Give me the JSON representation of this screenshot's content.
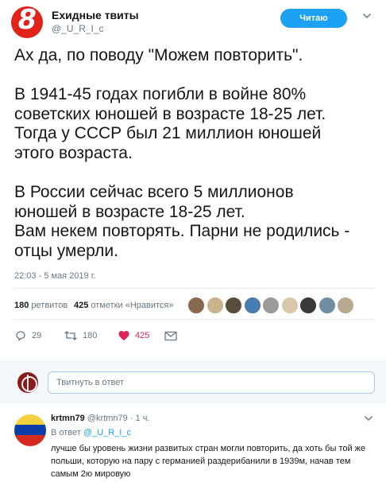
{
  "account": {
    "avatar_text": "8",
    "name": "Ехидные твиты",
    "handle": "@_U_R_I_c",
    "follow_label": "Читаю"
  },
  "tweet": {
    "lines": [
      "Ах да, по поводу \"Можем повторить\".",
      "",
      "В 1941-45 годах погибли в войне 80%",
      "советских юношей в возрасте 18-25 лет.",
      "Тогда у СССР был 21 миллион юношей",
      "этого возраста.",
      "",
      "В России сейчас всего 5 миллионов",
      "юношей в возрасте 18-25 лет.",
      "Вам некем повторять. Парни не родились -",
      "отцы умерли."
    ],
    "timestamp": "22:03 - 5 мая 2019 г."
  },
  "stats": {
    "retweets_count": "180",
    "retweets_label": "ретвитов",
    "likes_count": "425",
    "likes_label": "отметки «Нравится»"
  },
  "likers": [
    "#8a6a4f",
    "#c9b38a",
    "#5b4b3a",
    "#4a7bb0",
    "#9a9a9a",
    "#d8c8a8",
    "#3a3a3a",
    "#6f8fa0",
    "#b8a890"
  ],
  "actions": {
    "reply_count": "29",
    "retweet_count": "180",
    "like_count": "425"
  },
  "reply_box": {
    "placeholder": "Твитнуть в ответ"
  },
  "reply": {
    "name": "krtmn79",
    "handle_time": "@krtmn79 · 1 ч.",
    "reply_prefix": "В ответ",
    "reply_to": "@_U_R_I_c",
    "text": "лучше бы уровень жизни развитых стран могли повторить, да хоть бы той же польши, которую на пару с германией раздерибанили в 1939м, начав тем самым 2ю мировую"
  },
  "colors": {
    "accent": "#1da1f2",
    "like": "#e0245e",
    "muted": "#657786",
    "flag_yellow": "#f4d03f",
    "flag_blue": "#0b3ea8",
    "flag_red": "#d52b1e"
  }
}
